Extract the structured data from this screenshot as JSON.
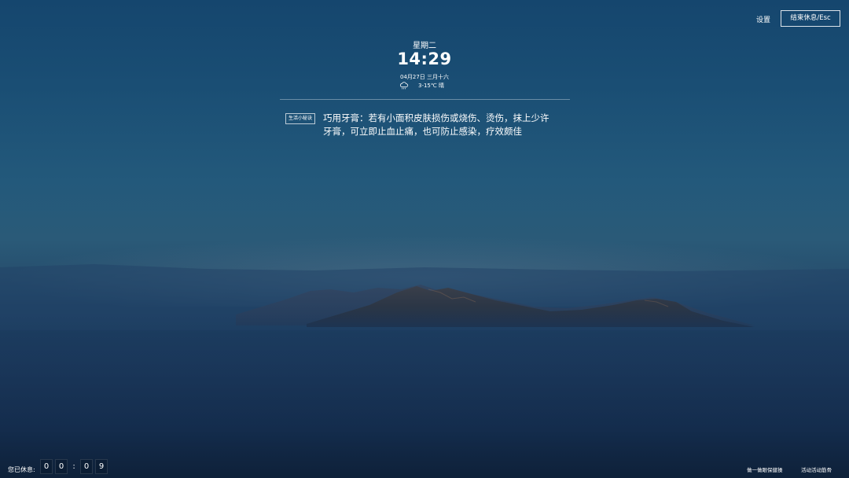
{
  "header": {
    "settings_label": "设置",
    "end_break_label": "结束休息/Esc"
  },
  "clock": {
    "weekday": "星期二",
    "time": "14:29",
    "date": "04月27日 三月十六",
    "weather_icon": "cloud-rain-icon",
    "temperature": "3-15℃ 晴"
  },
  "tip": {
    "tag": "生活小秘诀",
    "lines": [
      "巧用牙膏：若有小面积皮肤损伤或烧伤、烫伤，抹上少许",
      "牙膏，可立即止血止痛，也可防止感染，疗效颇佳"
    ]
  },
  "footer": {
    "rest_label": "您已休息:",
    "timer_digits": [
      "0",
      "0",
      "0",
      "9"
    ],
    "timer_separator": ":",
    "link_eye_exercise": "做一做眼保健操",
    "link_activity_guide": "活动活动筋骨"
  },
  "colors": {
    "sky_top": "#15466e",
    "sky_bottom": "#0f253f"
  }
}
